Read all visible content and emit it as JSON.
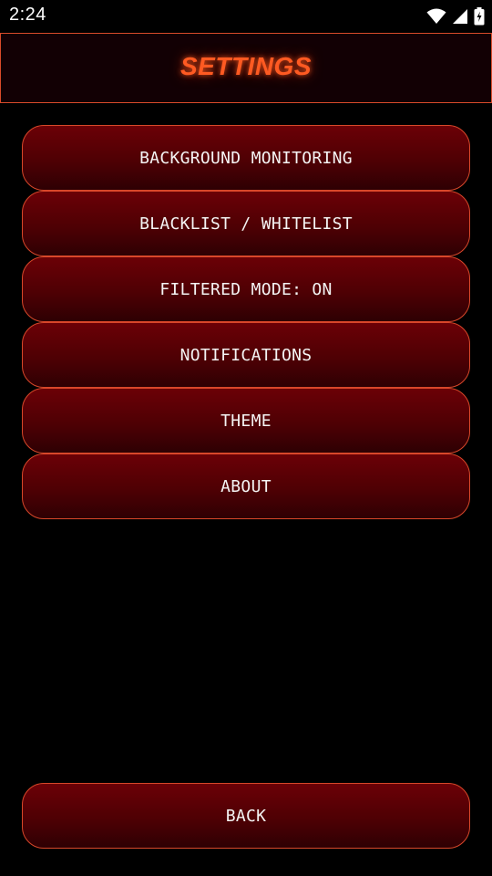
{
  "status_bar": {
    "time": "2:24",
    "icons": [
      "wifi-icon",
      "signal-icon",
      "battery-charging-icon"
    ]
  },
  "header": {
    "title": "SETTINGS"
  },
  "menu": {
    "items": [
      {
        "label": "BACKGROUND MONITORING"
      },
      {
        "label": "BLACKLIST / WHITELIST"
      },
      {
        "label": "FILTERED MODE: ON"
      },
      {
        "label": "NOTIFICATIONS"
      },
      {
        "label": "THEME"
      },
      {
        "label": "ABOUT"
      }
    ]
  },
  "footer": {
    "back_label": "BACK"
  },
  "colors": {
    "background": "#000000",
    "accent": "#ff5a22",
    "border": "#d8472a",
    "button_fill": "#5a0005"
  }
}
